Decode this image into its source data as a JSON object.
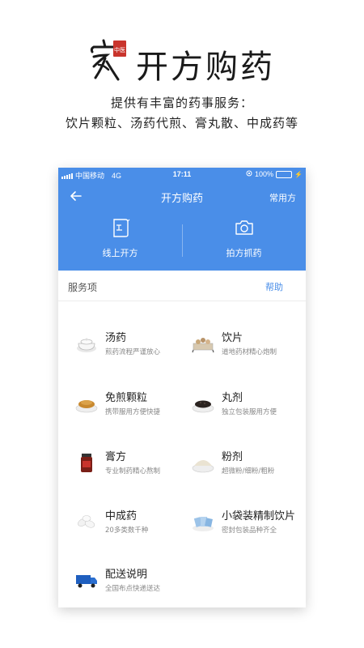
{
  "promo": {
    "logo_seal_text": "中医",
    "title": "开方购药",
    "subtitle_line1": "提供有丰富的药事服务：",
    "subtitle_line2": "饮片颗粒、汤药代煎、膏丸散、中成药等"
  },
  "status_bar": {
    "carrier": "中国移动",
    "network": "4G",
    "time": "17:11",
    "battery": "100%",
    "battery_level": 1.0
  },
  "navbar": {
    "back_icon": "arrow-left-icon",
    "title": "开方购药",
    "right_label": "常用方"
  },
  "actions": [
    {
      "label": "线上开方",
      "icon": "prescription-icon"
    },
    {
      "label": "拍方抓药",
      "icon": "camera-icon"
    }
  ],
  "services": {
    "title": "服务项",
    "help_label": "帮助",
    "items": [
      {
        "name": "汤药",
        "desc": "煎药流程严谨放心",
        "icon": "decoction-bowl-icon"
      },
      {
        "name": "饮片",
        "desc": "道地药材精心炮制",
        "icon": "herb-slices-icon"
      },
      {
        "name": "免煎颗粒",
        "desc": "携带服用方便快捷",
        "icon": "granules-icon"
      },
      {
        "name": "丸剂",
        "desc": "独立包装服用方便",
        "icon": "pills-icon"
      },
      {
        "name": "膏方",
        "desc": "专业制药精心熬制",
        "icon": "paste-jar-icon"
      },
      {
        "name": "粉剂",
        "desc": "超微粉/细粉/粗粉",
        "icon": "powder-icon"
      },
      {
        "name": "中成药",
        "desc": "20多类数千种",
        "icon": "capsules-icon"
      },
      {
        "name": "小袋装精制饮片",
        "desc": "密封包装品种齐全",
        "icon": "small-bags-icon"
      },
      {
        "name": "配送说明",
        "desc": "全国布点快递送达",
        "icon": "delivery-truck-icon"
      }
    ]
  },
  "colors": {
    "primary": "#4a8ee8",
    "logo_red": "#c9342c"
  }
}
